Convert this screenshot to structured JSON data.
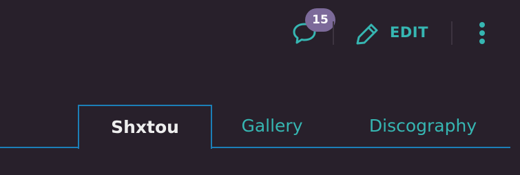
{
  "colors": {
    "background": "#28202b",
    "accent": "#36b6b2",
    "badge": "#7c6a9a",
    "tab_border": "#1c7fb8",
    "active_tab_text": "#eeeeee"
  },
  "toolbar": {
    "comments": {
      "icon": "speech-bubble-icon",
      "count": "15"
    },
    "edit": {
      "icon": "pencil-icon",
      "label": "EDIT"
    },
    "more": {
      "icon": "vertical-ellipsis-icon"
    }
  },
  "tabs": [
    {
      "label": "Shxtou",
      "active": true
    },
    {
      "label": "Gallery",
      "active": false
    },
    {
      "label": "Discography",
      "active": false
    }
  ]
}
